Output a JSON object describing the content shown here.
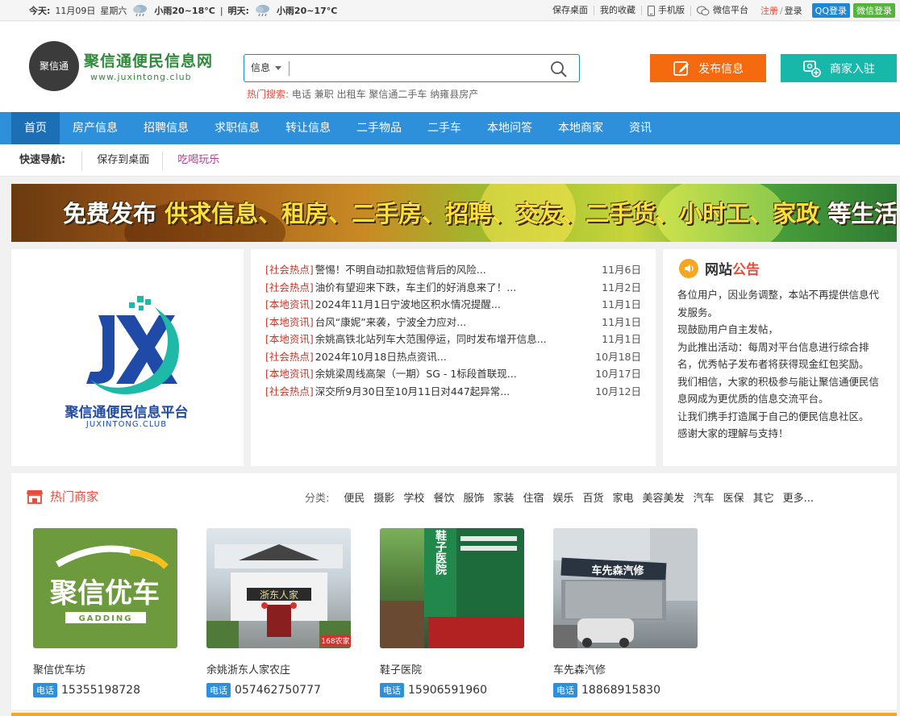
{
  "topbar": {
    "today_label": "今天:",
    "today_date": "11月09日",
    "today_weekday": "星期六",
    "today_weather": "小雨20~18°C",
    "sep": "|",
    "tomorrow_label": "明天:",
    "tomorrow_weather": "小雨20~17°C",
    "links": [
      "保存桌面",
      "我的收藏",
      "手机版",
      "微信平台"
    ],
    "register": "注册",
    "slash": "/",
    "login": "登录",
    "qq_login": "QQ登录",
    "wx_login": "微信登录"
  },
  "header": {
    "logo_mark": "聚信通",
    "logo_title": "聚信通便民信息网",
    "logo_url": "www.juxintong.club",
    "search_select": "信息",
    "search_value": "",
    "hot_label": "热门搜索:",
    "hot_keywords": [
      "电话",
      "兼职",
      "出租车",
      "聚信通二手车",
      "纳雍县房产"
    ],
    "post_button": "发布信息",
    "shop_button": "商家入驻"
  },
  "nav": {
    "items": [
      "首页",
      "房产信息",
      "招聘信息",
      "求职信息",
      "转让信息",
      "二手物品",
      "二手车",
      "本地问答",
      "本地商家",
      "资讯"
    ]
  },
  "quick": {
    "label": "快速导航:",
    "items": [
      "保存到桌面",
      "吃喝玩乐"
    ]
  },
  "banner": {
    "part1": "免费发布",
    "part2": "供求信息、租房、二手房、招聘、交友、二手货、小时工、家政",
    "part3": "等生活分类信息"
  },
  "platform_logo": {
    "title": "聚信通便民信息平台",
    "subtitle": "JUXINTONG.CLUB"
  },
  "news": [
    {
      "cat": "[社会热点]",
      "title": "警惕！不明自动扣款短信背后的风险...",
      "date": "11月6日"
    },
    {
      "cat": "[社会热点]",
      "title": "油价有望迎来下跌，车主们的好消息来了！...",
      "date": "11月2日"
    },
    {
      "cat": "[本地资讯]",
      "title": "2024年11月1日宁波地区积水情况提醒...",
      "date": "11月1日"
    },
    {
      "cat": "[本地资讯]",
      "title": "台风“康妮”来袭，宁波全力应对...",
      "date": "11月1日"
    },
    {
      "cat": "[本地资讯]",
      "title": "余姚高铁北站列车大范围停运，同时发布增开信息...",
      "date": "11月1日"
    },
    {
      "cat": "[社会热点]",
      "title": "2024年10月18日热点资讯...",
      "date": "10月18日"
    },
    {
      "cat": "[本地资讯]",
      "title": "余姚梁周线高架（一期）SG - 1标段首联现...",
      "date": "10月17日"
    },
    {
      "cat": "[社会热点]",
      "title": "深交所9月30日至10月11日对447起异常...",
      "date": "10月12日"
    }
  ],
  "notice": {
    "title_a": "网站",
    "title_b": "公告",
    "lines": [
      "各位用户，因业务调整，本站不再提供信息代发服务。",
      "现鼓励用户自主发帖，",
      "为此推出活动：每周对平台信息进行综合排名，优秀帖子发布者将获得现金红包奖励。",
      "我们相信，大家的积极参与能让聚信通便民信息网成为更优质的信息交流平台。",
      "让我们携手打造属于自己的便民信息社区。",
      "感谢大家的理解与支持！"
    ]
  },
  "merchants": {
    "title": "热门商家",
    "cat_label": "分类:",
    "cats": [
      "便民",
      "摄影",
      "学校",
      "餐饮",
      "服饰",
      "家装",
      "住宿",
      "娱乐",
      "百货",
      "家电",
      "美容美发",
      "汽车",
      "医保",
      "其它",
      "更多..."
    ],
    "tel_tag": "电话",
    "items": [
      {
        "name": "聚信优车坊",
        "tel": "15355198728",
        "img_text": "聚信优车",
        "img_sub": "GADDING"
      },
      {
        "name": "余姚浙东人家农庄",
        "tel": "057462750777",
        "img_text": "浙东人家",
        "img_sub": "168农家"
      },
      {
        "name": "鞋子医院",
        "tel": "15906591960",
        "img_text": "鞋子医院",
        "img_sub": ""
      },
      {
        "name": "车先森汽修",
        "tel": "18868915830",
        "img_text": "车先森汽修",
        "img_sub": ""
      }
    ]
  }
}
